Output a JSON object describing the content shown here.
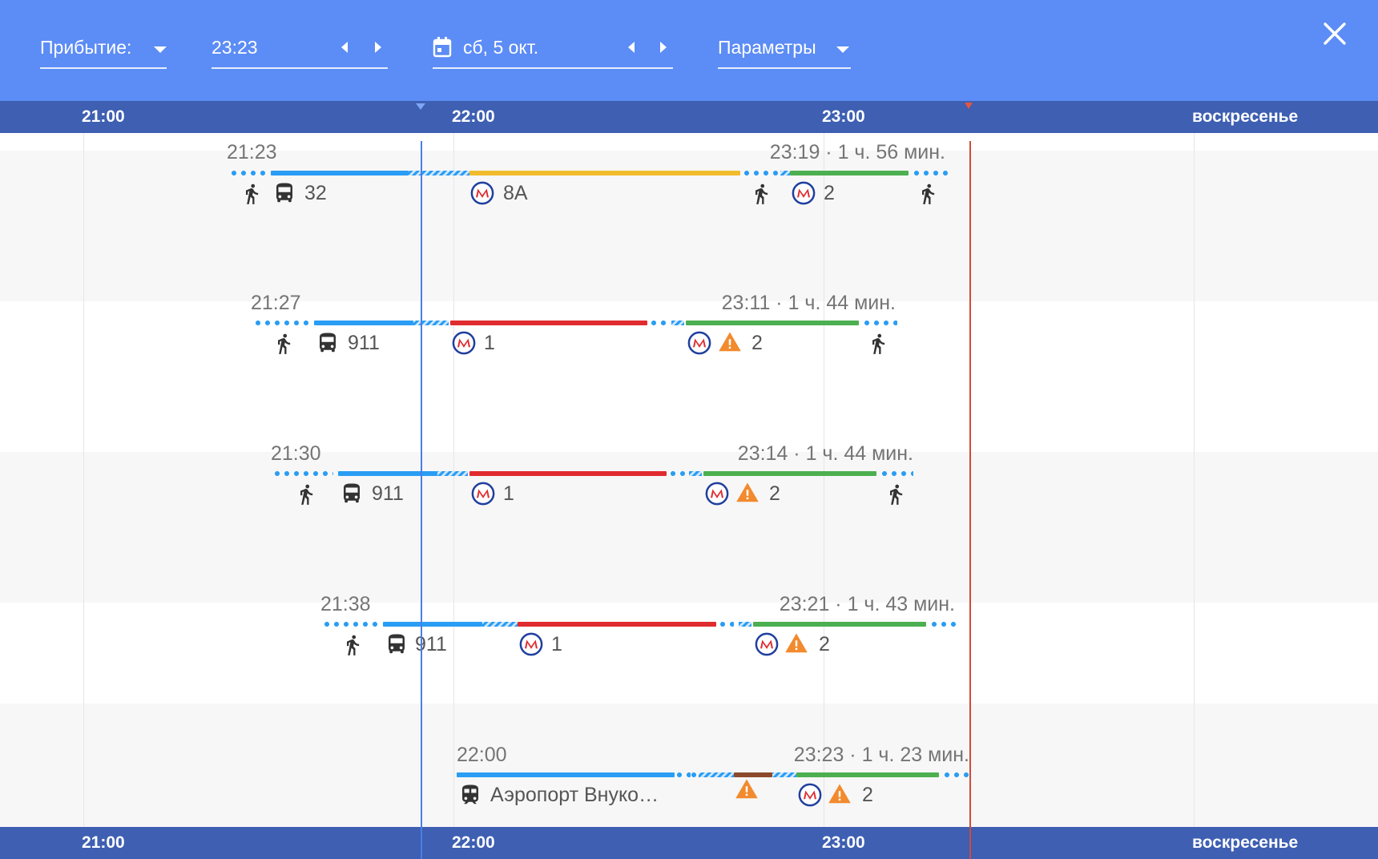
{
  "header": {
    "mode_label": "Прибытие:",
    "time_value": "23:23",
    "date_value": "сб, 5 окт.",
    "options_label": "Параметры"
  },
  "axis": {
    "ticks": [
      "21:00",
      "22:00",
      "23:00"
    ],
    "day_label": "воскресенье"
  },
  "colors": {
    "header": "#5c8cf5",
    "axis": "#3e5fb2",
    "bus": "#2a9df4",
    "metro_8a": "#f0bc2e",
    "metro_1": "#e02b2f",
    "metro_2": "#4caf50",
    "brown": "#8b4a2b",
    "warning": "#f28a2e"
  },
  "routes": [
    {
      "depart": "21:23",
      "arrive_info": "23:19 · 1 ч. 56 мин.",
      "labels": [
        "32",
        "8А",
        "2"
      ],
      "icons": [
        "walk-icon",
        "bus-icon",
        "metro-icon",
        "walk-icon",
        "metro-icon",
        "walk-icon"
      ]
    },
    {
      "depart": "21:27",
      "arrive_info": "23:11 · 1 ч. 44 мин.",
      "labels": [
        "911",
        "1",
        "2"
      ],
      "icons": [
        "walk-icon",
        "bus-icon",
        "metro-icon",
        "metro-icon",
        "warning-icon",
        "walk-icon"
      ]
    },
    {
      "depart": "21:30",
      "arrive_info": "23:14 · 1 ч. 44 мин.",
      "labels": [
        "911",
        "1",
        "2"
      ],
      "icons": [
        "walk-icon",
        "bus-icon",
        "metro-icon",
        "metro-icon",
        "warning-icon",
        "walk-icon"
      ]
    },
    {
      "depart": "21:38",
      "arrive_info": "23:21 · 1 ч. 43 мин.",
      "labels": [
        "911",
        "1",
        "2"
      ],
      "icons": [
        "walk-icon",
        "bus-icon",
        "metro-icon",
        "metro-icon",
        "warning-icon"
      ]
    },
    {
      "depart": "22:00",
      "arrive_info": "23:23 · 1 ч. 23 мин.",
      "labels": [
        "Аэропорт Внуко…",
        "2"
      ],
      "icons": [
        "train-icon",
        "warning-icon",
        "metro-icon",
        "warning-icon"
      ]
    }
  ]
}
